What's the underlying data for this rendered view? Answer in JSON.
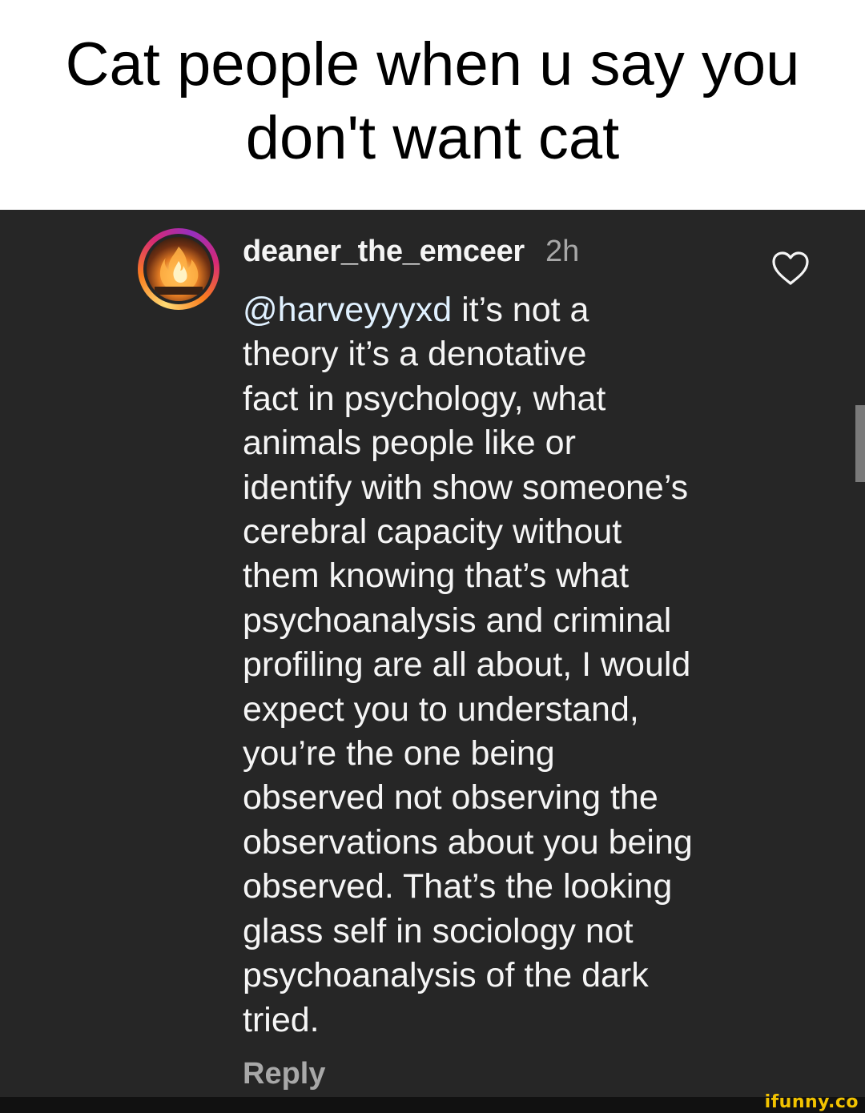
{
  "caption": {
    "text": "Cat  people when u say you don't want cat"
  },
  "comment": {
    "username": "deaner_the_emceer",
    "timestamp": "2h",
    "mention": "@harveyyyxd",
    "body": " it’s not a\ntheory it’s a denotative\nfact in psychology, what\nanimals people like or\nidentify with show someone’s\ncerebral capacity without\nthem knowing that’s what\npsychoanalysis and criminal\nprofiling are all about, I would\nexpect you to understand,\nyou’re the one being\nobserved not observing the\nobservations about you being\nobserved. That’s the looking\nglass self in sociology not\npsychoanalysis of the dark\ntried.",
    "reply_label": "Reply",
    "icons": {
      "like": "heart-outline-icon"
    },
    "colors": {
      "background": "#262626",
      "text": "#f5f5f5",
      "muted": "#a8a8a8",
      "mention": "#e0f1ff"
    }
  },
  "watermark": {
    "text": "ifunny.co",
    "color": "#f2c300"
  }
}
